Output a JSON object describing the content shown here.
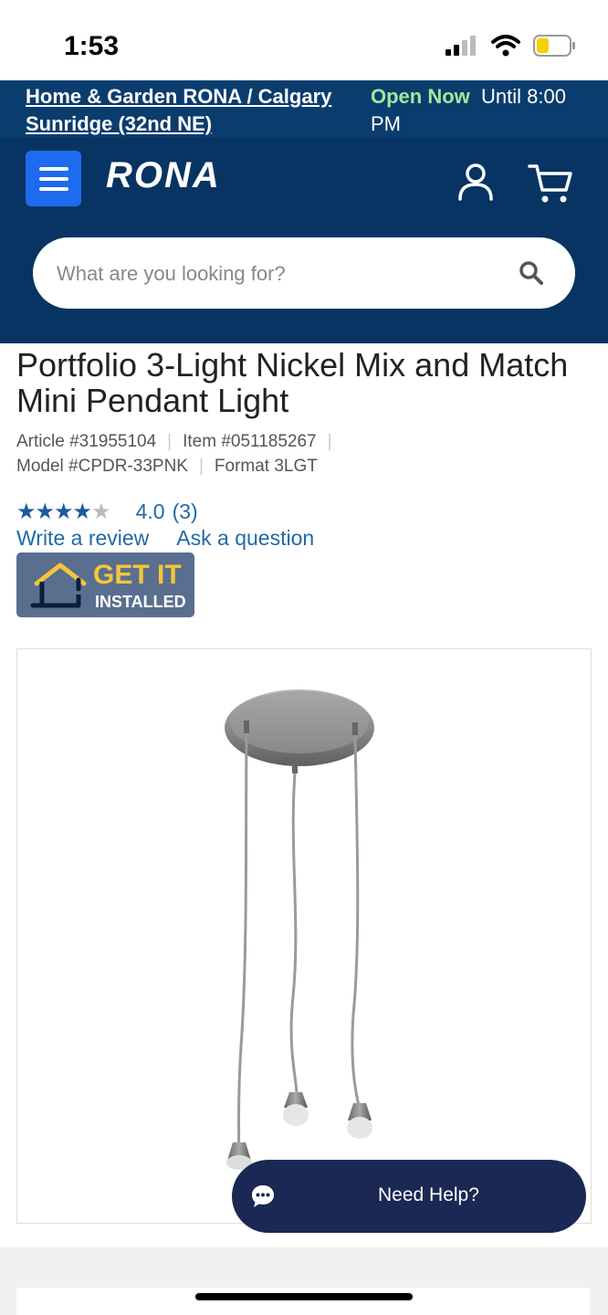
{
  "status": {
    "time": "1:53"
  },
  "store": {
    "name": "Home & Garden RONA / Calgary Sunridge (32nd NE)",
    "open_label": "Open Now",
    "hours": "Until 8:00 PM"
  },
  "header": {
    "logo": "RONA",
    "search_placeholder": "What are you looking for?"
  },
  "product": {
    "title": "Portfolio 3-Light Nickel Mix and Match Mini Pendant Light",
    "article": "Article #31955104",
    "item": "Item #051185267",
    "model": "Model #CPDR-33PNK",
    "format": "Format 3LGT",
    "rating_value": "4.0",
    "rating_count": "(3)",
    "rating_stars": 4,
    "write_review": "Write a review",
    "ask_question": "Ask a question"
  },
  "badge": {
    "line1": "GET IT",
    "line2": "INSTALLED"
  },
  "help": {
    "label": "Need Help?"
  },
  "colors": {
    "brand_navy": "#073463",
    "store_bar": "#0a3d6e",
    "menu_blue": "#1e6bf0",
    "link_blue": "#1e6aa8",
    "open_green": "#a6e59a",
    "help_bg": "#1b2854"
  },
  "icons": [
    "signal-icon",
    "wifi-icon",
    "battery-icon",
    "menu-icon",
    "account-icon",
    "cart-icon",
    "search-icon",
    "house-icon",
    "chat-icon"
  ]
}
